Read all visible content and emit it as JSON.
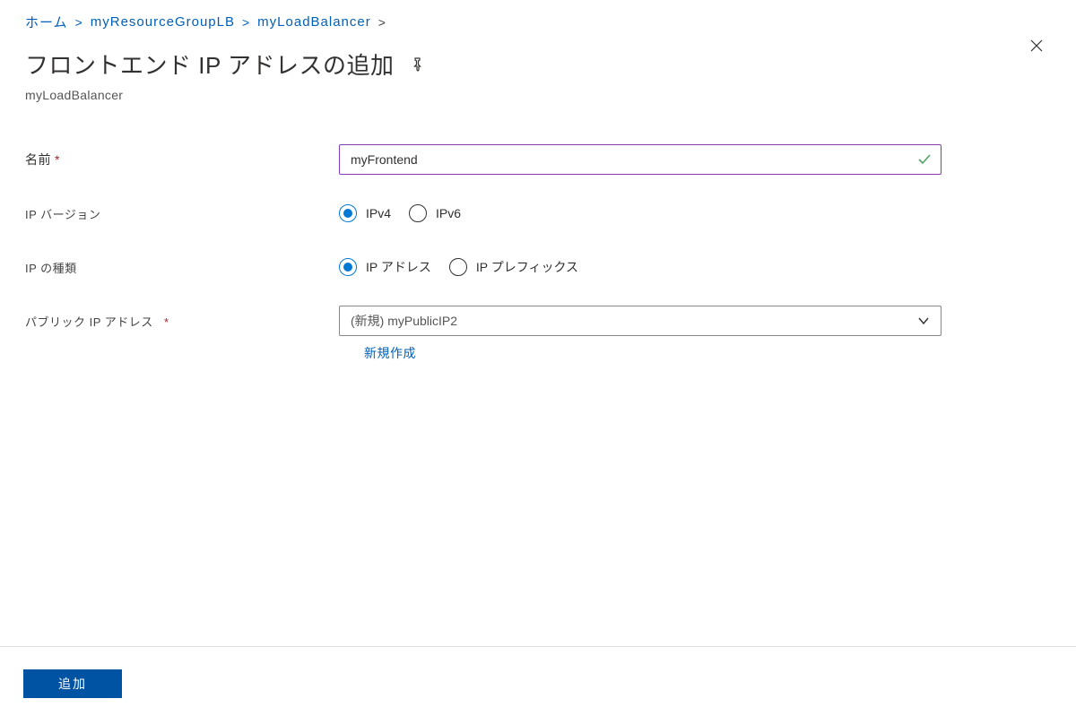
{
  "breadcrumb": {
    "home": "ホーム",
    "rg": "myResourceGroupLB",
    "lb": "myLoadBalancer",
    "sep": ">"
  },
  "header": {
    "title": "フロントエンド IP アドレスの追加",
    "subtitle": "myLoadBalancer"
  },
  "form": {
    "name_label": "名前",
    "name_value": "myFrontend",
    "ip_version_label": "IP バージョン",
    "ip_version_options": {
      "ipv4": "IPv4",
      "ipv6": "IPv6"
    },
    "ip_type_label": "IP の種類",
    "ip_type_options": {
      "address": "IP アドレス",
      "prefix": "IP プレフィックス"
    },
    "public_ip_label": "パブリック IP アドレス",
    "public_ip_value": "(新規) myPublicIP2",
    "create_new_link": "新規作成"
  },
  "footer": {
    "add_button": "追加"
  }
}
